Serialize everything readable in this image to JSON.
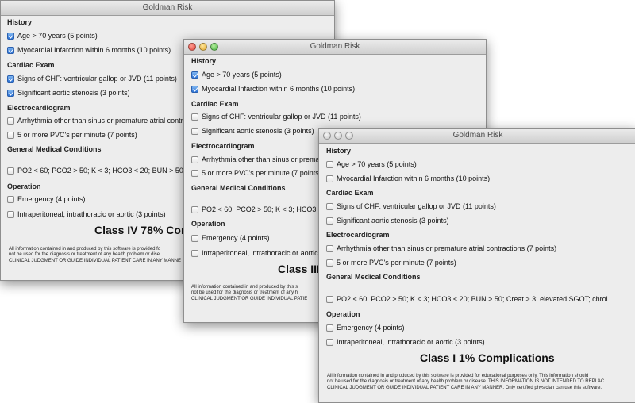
{
  "windows": [
    {
      "title": "Goldman Risk",
      "sections": {
        "history": "History",
        "cardiac": "Cardiac Exam",
        "ecg": "Electrocardiogram",
        "general": "General Medical Conditions",
        "operation": "Operation"
      },
      "options": {
        "age": "Age > 70 years (5 points)",
        "mi": "Myocardial Infarction within 6 months (10 points)",
        "chf": "Signs of CHF: ventricular gallop or JVD (11 points)",
        "aortic": "Significant aortic stenosis (3 points)",
        "arrhythmia": "Arrhythmia other than sinus or premature atrial contr",
        "pvc": "5 or more PVC's per minute (7 points)",
        "general": "PO2 < 60; PCO2 > 50; K < 3; HCO3 < 20; BUN > 50;",
        "emergency": "Emergency (4 points)",
        "intra": "Intraperitoneal, intrathoracic or aortic (3 points)"
      },
      "checked": [
        "age",
        "mi",
        "chf",
        "aortic"
      ],
      "result": "Class IV 78% Com",
      "disclaimer": [
        "All information contained in and produced by this software is provided fo",
        "not be used for the diagnosis or treatment of any health problem or dise",
        "CLINICAL JUDGMENT OR GUIDE INDIVIDUAL PATIENT CARE IN ANY MANNE"
      ]
    },
    {
      "title": "Goldman Risk",
      "sections": {
        "history": "History",
        "cardiac": "Cardiac Exam",
        "ecg": "Electrocardiogram",
        "general": "General Medical Conditions",
        "operation": "Operation"
      },
      "options": {
        "age": "Age > 70 years (5 points)",
        "mi": "Myocardial Infarction within 6 months (10 points)",
        "chf": "Signs of CHF: ventricular gallop or JVD (11 points)",
        "aortic": "Significant aortic stenosis (3 points)",
        "arrhythmia": "Arrhythmia other than sinus or prema",
        "pvc": "5 or more PVC's per minute (7 points)",
        "general": "PO2 < 60; PCO2 > 50; K < 3; HCO3 <",
        "emergency": "Emergency (4 points)",
        "intra": "Intraperitoneal, intrathoracic or aortic"
      },
      "checked": [
        "age",
        "mi"
      ],
      "result": "Class III",
      "disclaimer": [
        "All information contained in and produced by this s",
        "not be used for the diagnosis or treatment of any h",
        "CLINICAL JUDGMENT OR GUIDE INDIVIDUAL PATIE"
      ]
    },
    {
      "title": "Goldman Risk",
      "sections": {
        "history": "History",
        "cardiac": "Cardiac Exam",
        "ecg": "Electrocardiogram",
        "general": "General Medical Conditions",
        "operation": "Operation"
      },
      "options": {
        "age": "Age > 70 years (5 points)",
        "mi": "Myocardial Infarction within 6 months (10 points)",
        "chf": "Signs of CHF: ventricular gallop or JVD (11 points)",
        "aortic": "Significant aortic stenosis (3 points)",
        "arrhythmia": "Arrhythmia other than sinus or premature atrial contractions (7 points)",
        "pvc": "5 or more PVC's per minute (7 points)",
        "general": "PO2 < 60; PCO2 > 50; K < 3; HCO3 < 20; BUN > 50; Creat > 3; elevated SGOT; chroi",
        "emergency": "Emergency (4 points)",
        "intra": "Intraperitoneal, intrathoracic or aortic (3 points)"
      },
      "checked": [],
      "result": "Class I 1% Complications",
      "disclaimer": [
        "All information contained in and produced by this software is provided for educational purposes only. This information should",
        "not be used for the diagnosis or treatment of any health problem or disease. THIS INFORMATION IS NOT INTENDED TO REPLAC",
        "CLINICAL JUDGMENT OR GUIDE INDIVIDUAL PATIENT CARE IN ANY MANNER. Only certified physician can use this software."
      ]
    }
  ],
  "colors": {
    "window_bg": "#ededed",
    "checkbox_checked": "#2d74d8",
    "close": "#e0443a",
    "minimize": "#e0a62a",
    "zoom": "#3fae3a"
  }
}
